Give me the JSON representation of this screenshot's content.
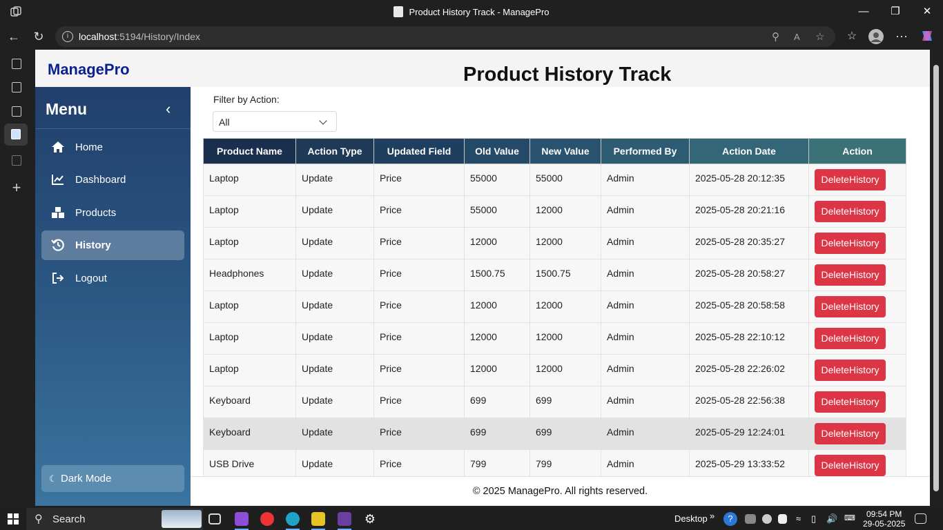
{
  "browser": {
    "window_title": "Product History Track - ManagePro",
    "url_host": "localhost",
    "url_rest": ":5194/History/Index"
  },
  "header": {
    "brand": "ManagePro",
    "title": "Product History Track"
  },
  "sidebar": {
    "menu_title": "Menu",
    "collapse_icon": "‹",
    "items": [
      {
        "label": "Home",
        "icon": "home-icon"
      },
      {
        "label": "Dashboard",
        "icon": "chart-line-icon"
      },
      {
        "label": "Products",
        "icon": "boxes-icon"
      },
      {
        "label": "History",
        "icon": "history-icon",
        "active": true
      },
      {
        "label": "Logout",
        "icon": "logout-icon"
      }
    ],
    "dark_mode_label": "Dark Mode"
  },
  "filter": {
    "label": "Filter by Action:",
    "selected": "All"
  },
  "table": {
    "header_colors": [
      "#1a2f4d",
      "#1e3a57",
      "#1f3f5e",
      "#244a68",
      "#28526d",
      "#2d5b72",
      "#336677",
      "#3b7278"
    ],
    "columns": [
      "Product Name",
      "Action Type",
      "Updated Field",
      "Old Value",
      "New Value",
      "Performed By",
      "Action Date",
      "Action"
    ],
    "rows": [
      [
        "Laptop",
        "Update",
        "Price",
        "55000",
        "55000",
        "Admin",
        "2025-05-28 20:12:35"
      ],
      [
        "Laptop",
        "Update",
        "Price",
        "55000",
        "12000",
        "Admin",
        "2025-05-28 20:21:16"
      ],
      [
        "Laptop",
        "Update",
        "Price",
        "12000",
        "12000",
        "Admin",
        "2025-05-28 20:35:27"
      ],
      [
        "Headphones",
        "Update",
        "Price",
        "1500.75",
        "1500.75",
        "Admin",
        "2025-05-28 20:58:27"
      ],
      [
        "Laptop",
        "Update",
        "Price",
        "12000",
        "12000",
        "Admin",
        "2025-05-28 20:58:58"
      ],
      [
        "Laptop",
        "Update",
        "Price",
        "12000",
        "12000",
        "Admin",
        "2025-05-28 22:10:12"
      ],
      [
        "Laptop",
        "Update",
        "Price",
        "12000",
        "12000",
        "Admin",
        "2025-05-28 22:26:02"
      ],
      [
        "Keyboard",
        "Update",
        "Price",
        "699",
        "699",
        "Admin",
        "2025-05-28 22:56:38"
      ],
      [
        "Keyboard",
        "Update",
        "Price",
        "699",
        "699",
        "Admin",
        "2025-05-29 12:24:01"
      ],
      [
        "USB Drive",
        "Update",
        "Price",
        "799",
        "799",
        "Admin",
        "2025-05-29 13:33:52"
      ]
    ],
    "highlighted_row": 8,
    "delete_label": "DeleteHistory",
    "delete_color": "#dc3545"
  },
  "footer": {
    "text": "© 2025 ManagePro. All rights reserved."
  },
  "taskbar": {
    "search_label": "Search",
    "desktop_label": "Desktop",
    "time": "09:54 PM",
    "date": "29-05-2025"
  }
}
